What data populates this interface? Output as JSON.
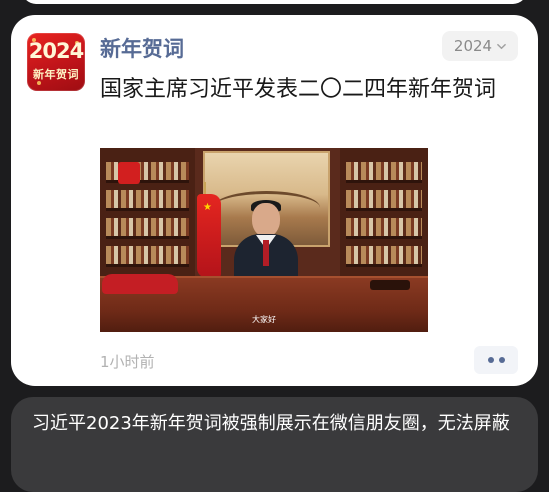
{
  "post": {
    "app_icon": {
      "year": "2024",
      "subtitle": "新年贺词"
    },
    "app_name": "新年贺词",
    "tag": {
      "label": "2024",
      "icon": "chevron-down-icon"
    },
    "headline": "国家主席习近平发表二〇二四年新年贺词",
    "video": {
      "subtitle": "大家好"
    },
    "time_ago": "1小时前",
    "more_icon": "more-dots-icon"
  },
  "caption": {
    "text": "习近平2023年新年贺词被强制展示在微信朋友圈，无法屏蔽"
  },
  "colors": {
    "background": "#1c1c1e",
    "card": "#ffffff",
    "link_blue": "#576b95",
    "caption_bg": "#3a3a3c",
    "icon_red": "#d7201c"
  }
}
